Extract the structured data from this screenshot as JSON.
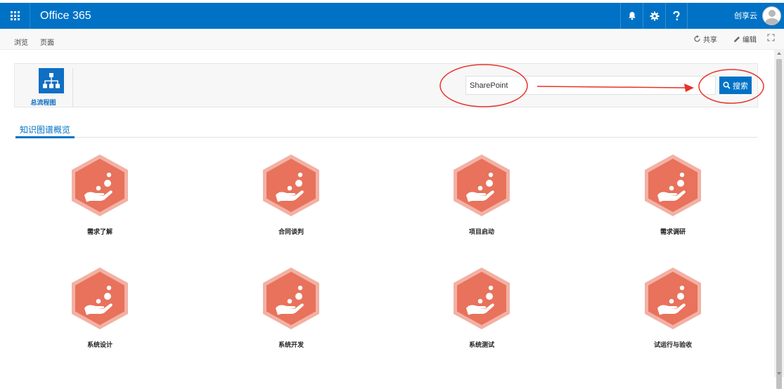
{
  "suite_bar": {
    "brand": "Office 365",
    "user_name": "创享云",
    "colors": {
      "background": "#0072c6",
      "text": "#ffffff"
    },
    "icons": [
      "waffle-icon",
      "bell-icon",
      "gear-icon",
      "help-icon",
      "avatar"
    ]
  },
  "ribbon": {
    "tabs": [
      "浏览",
      "页面"
    ],
    "actions": {
      "share": "共享",
      "edit": "编辑"
    }
  },
  "toolbox": {
    "flow_chart_label": "总流程图",
    "search": {
      "value": "SharePoint",
      "button_label": "搜索"
    }
  },
  "knowledge_graph": {
    "tab_label": "知识图谱概览",
    "nodes": [
      {
        "label": "需求了解"
      },
      {
        "label": "合同谈判"
      },
      {
        "label": "项目启动"
      },
      {
        "label": "需求调研"
      },
      {
        "label": "系统设计"
      },
      {
        "label": "系统开发"
      },
      {
        "label": "系统测试"
      },
      {
        "label": "试运行与验收"
      }
    ],
    "colors": {
      "hex_fill": "#e8725c",
      "hex_border": "#f2b1a4",
      "accent": "#0072c6"
    }
  }
}
